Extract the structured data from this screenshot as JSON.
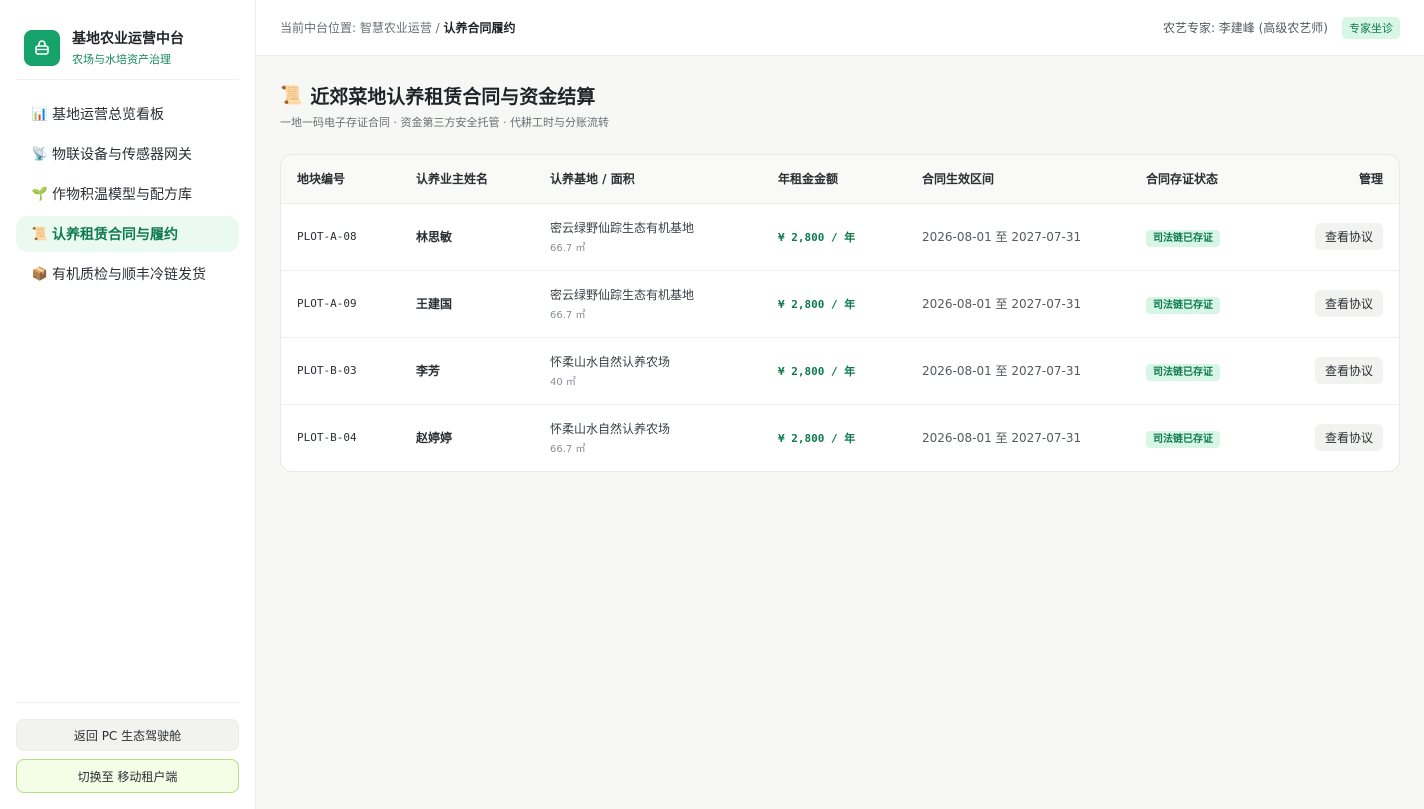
{
  "brand": {
    "title": "基地农业运营中台",
    "subtitle": "农场与水培资产治理",
    "icon": "basket-icon"
  },
  "nav": [
    {
      "icon": "📊",
      "label": "基地运营总览看板",
      "active": false
    },
    {
      "icon": "📡",
      "label": "物联设备与传感器网关",
      "active": false
    },
    {
      "icon": "🌱",
      "label": "作物积温模型与配方库",
      "active": false
    },
    {
      "icon": "📜",
      "label": "认养租赁合同与履约",
      "active": true
    },
    {
      "icon": "📦",
      "label": "有机质检与顺丰冷链发货",
      "active": false
    }
  ],
  "sidebar_bottom": {
    "back_label": "返回 PC 生态驾驶舱",
    "switch_label": "切换至 移动租户端"
  },
  "topbar": {
    "crumb_prefix": "当前中台位置: 智慧农业运营 / ",
    "crumb_current": "认养合同履约",
    "expert_text": "农艺专家: 李建峰 (高级农艺师)",
    "expert_badge": "专家坐诊"
  },
  "page": {
    "icon": "📜",
    "title": "近郊菜地认养租赁合同与资金结算",
    "subtitle": "一地一码电子存证合同 · 资金第三方安全托管 · 代耕工时与分账流转"
  },
  "table": {
    "headers": [
      "地块编号",
      "认养业主姓名",
      "认养基地 / 面积",
      "年租金金额",
      "合同生效区间",
      "合同存证状态",
      "管理"
    ],
    "rows": [
      {
        "plot": "PLOT-A-08",
        "owner": "林思敏",
        "base": "密云绿野仙踪生态有机基地",
        "area": "66.7 ㎡",
        "rent": "¥ 2,800 / 年",
        "period": "2026-08-01 至 2027-07-31",
        "status": "司法链已存证",
        "action": "查看协议"
      },
      {
        "plot": "PLOT-A-09",
        "owner": "王建国",
        "base": "密云绿野仙踪生态有机基地",
        "area": "66.7 ㎡",
        "rent": "¥ 2,800 / 年",
        "period": "2026-08-01 至 2027-07-31",
        "status": "司法链已存证",
        "action": "查看协议"
      },
      {
        "plot": "PLOT-B-03",
        "owner": "李芳",
        "base": "怀柔山水自然认养农场",
        "area": "40 ㎡",
        "rent": "¥ 2,800 / 年",
        "period": "2026-08-01 至 2027-07-31",
        "status": "司法链已存证",
        "action": "查看协议"
      },
      {
        "plot": "PLOT-B-04",
        "owner": "赵婷婷",
        "base": "怀柔山水自然认养农场",
        "area": "66.7 ㎡",
        "rent": "¥ 2,800 / 年",
        "period": "2026-08-01 至 2027-07-31",
        "status": "司法链已存证",
        "action": "查看协议"
      }
    ]
  }
}
